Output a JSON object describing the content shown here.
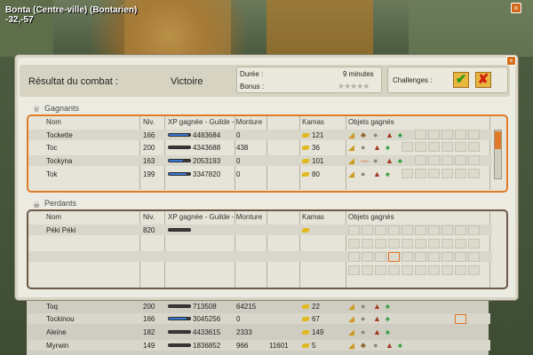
{
  "location": {
    "line1": "Bonta (Centre-ville) (Bontarien)",
    "line2": "-32,-57"
  },
  "window": {
    "close_glyph": "×"
  },
  "header": {
    "title": "Résultat du combat :",
    "result": "Victoire",
    "duration_label": "Durée :",
    "duration_value": "9 minutes",
    "bonus_label": "Bonus :",
    "bonus_stars": "★★★★★",
    "challenges_label": "Challenges :",
    "ok_glyph": "✔",
    "fail_glyph": "✘"
  },
  "columns": {
    "name": "Nom",
    "level": "Niv.",
    "xp": "XP gagnée - Guilde - Monture",
    "kamas": "Kamas",
    "objects": "Objets gagnés"
  },
  "winners": {
    "title": "Gagnants",
    "icon": "trophy-icon",
    "rows": [
      {
        "name": "Tockette",
        "level": "166",
        "xp": "4483684",
        "guild": "0",
        "mount": "",
        "kamas": "121",
        "fill": 0.9
      },
      {
        "name": "Toc",
        "level": "200",
        "xp": "4343688",
        "guild": "438",
        "mount": "",
        "kamas": "36",
        "fill": 0.0
      },
      {
        "name": "Tockyna",
        "level": "163",
        "xp": "2053193",
        "guild": "0",
        "mount": "",
        "kamas": "101",
        "fill": 0.65
      },
      {
        "name": "Tok",
        "level": "199",
        "xp": "3347820",
        "guild": "0",
        "mount": "",
        "kamas": "80",
        "fill": 0.85
      }
    ]
  },
  "losers": {
    "title": "Perdants",
    "icon": "skull-icon",
    "rows": [
      {
        "name": "Péki Péki",
        "level": "820",
        "xp": "",
        "guild": "",
        "mount": "",
        "kamas": "",
        "fill": 0.0
      }
    ]
  },
  "background_rows": [
    {
      "name": "Toq",
      "level": "200",
      "xp": "713508",
      "guild": "64215",
      "mount": "",
      "kamas": "22",
      "fill": 0.0
    },
    {
      "name": "Tockinou",
      "level": "166",
      "xp": "3045256",
      "guild": "0",
      "mount": "",
      "kamas": "67",
      "fill": 0.85
    },
    {
      "name": "Aleïne",
      "level": "182",
      "xp": "4433615",
      "guild": "2333",
      "mount": "",
      "kamas": "149",
      "fill": 0.0
    },
    {
      "name": "Myrwin",
      "level": "149",
      "xp": "1836852",
      "guild": "966",
      "mount": "11601",
      "kamas": "5",
      "fill": 0.0
    }
  ],
  "colors": {
    "accent": "#e07a28",
    "xp_bar": "#3a7ad8",
    "kamas": "#e0b820"
  }
}
